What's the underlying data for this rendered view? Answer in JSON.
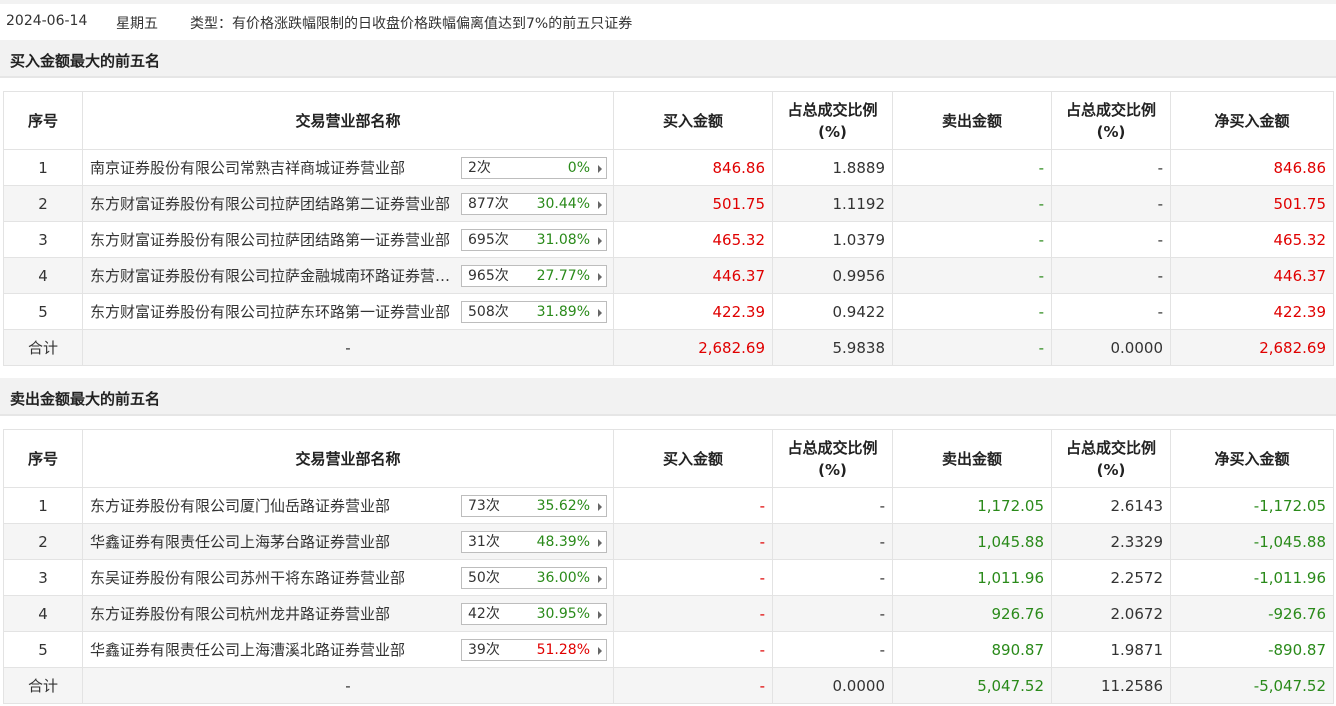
{
  "header": {
    "date": "2024-06-14",
    "weekday": "星期五",
    "type_text": "类型：有价格涨跌幅限制的日收盘价格跌幅偏离值达到7%的前五只证券"
  },
  "columns": {
    "seq": "序号",
    "name": "交易营业部名称",
    "buy": "买入金额",
    "buy_ratio_1": "占总成交比例",
    "buy_ratio_2": "(%)",
    "sell": "卖出金额",
    "sell_ratio_1": "占总成交比例",
    "sell_ratio_2": "(%)",
    "net": "净买入金额"
  },
  "buy_section": {
    "title": "买入金额最大的前五名",
    "rows": [
      {
        "seq": "1",
        "name": "南京证券股份有限公司常熟吉祥商城证券营业部",
        "count": "2次",
        "rate": "0%",
        "buy": "846.86",
        "buy_ratio": "1.8889",
        "sell": "-",
        "sell_ratio": "-",
        "net": "846.86"
      },
      {
        "seq": "2",
        "name": "东方财富证券股份有限公司拉萨团结路第二证券营业部",
        "count": "877次",
        "rate": "30.44%",
        "buy": "501.75",
        "buy_ratio": "1.1192",
        "sell": "-",
        "sell_ratio": "-",
        "net": "501.75"
      },
      {
        "seq": "3",
        "name": "东方财富证券股份有限公司拉萨团结路第一证券营业部",
        "count": "695次",
        "rate": "31.08%",
        "buy": "465.32",
        "buy_ratio": "1.0379",
        "sell": "-",
        "sell_ratio": "-",
        "net": "465.32"
      },
      {
        "seq": "4",
        "name": "东方财富证券股份有限公司拉萨金融城南环路证券营业部",
        "count": "965次",
        "rate": "27.77%",
        "buy": "446.37",
        "buy_ratio": "0.9956",
        "sell": "-",
        "sell_ratio": "-",
        "net": "446.37"
      },
      {
        "seq": "5",
        "name": "东方财富证券股份有限公司拉萨东环路第一证券营业部",
        "count": "508次",
        "rate": "31.89%",
        "buy": "422.39",
        "buy_ratio": "0.9422",
        "sell": "-",
        "sell_ratio": "-",
        "net": "422.39"
      }
    ],
    "total": {
      "label": "合计",
      "name": "-",
      "buy": "2,682.69",
      "buy_ratio": "5.9838",
      "sell": "-",
      "sell_ratio": "0.0000",
      "net": "2,682.69"
    }
  },
  "sell_section": {
    "title": "卖出金额最大的前五名",
    "rows": [
      {
        "seq": "1",
        "name": "东方证券股份有限公司厦门仙岳路证券营业部",
        "count": "73次",
        "rate": "35.62%",
        "buy": "-",
        "buy_ratio": "-",
        "sell": "1,172.05",
        "sell_ratio": "2.6143",
        "net": "-1,172.05"
      },
      {
        "seq": "2",
        "name": "华鑫证券有限责任公司上海茅台路证券营业部",
        "count": "31次",
        "rate": "48.39%",
        "buy": "-",
        "buy_ratio": "-",
        "sell": "1,045.88",
        "sell_ratio": "2.3329",
        "net": "-1,045.88"
      },
      {
        "seq": "3",
        "name": "东吴证券股份有限公司苏州干将东路证券营业部",
        "count": "50次",
        "rate": "36.00%",
        "buy": "-",
        "buy_ratio": "-",
        "sell": "1,011.96",
        "sell_ratio": "2.2572",
        "net": "-1,011.96"
      },
      {
        "seq": "4",
        "name": "东方证券股份有限公司杭州龙井路证券营业部",
        "count": "42次",
        "rate": "30.95%",
        "buy": "-",
        "buy_ratio": "-",
        "sell": "926.76",
        "sell_ratio": "2.0672",
        "net": "-926.76"
      },
      {
        "seq": "5",
        "name": "华鑫证券有限责任公司上海漕溪北路证券营业部",
        "count": "39次",
        "rate": "51.28%",
        "buy": "-",
        "buy_ratio": "-",
        "sell": "890.87",
        "sell_ratio": "1.9871",
        "net": "-890.87"
      }
    ],
    "total": {
      "label": "合计",
      "name": "-",
      "buy": "-",
      "buy_ratio": "0.0000",
      "sell": "5,047.52",
      "sell_ratio": "11.2586",
      "net": "-5,047.52"
    }
  },
  "colors": {
    "positive": "#e00000",
    "negative": "#2a8a1a",
    "header_bg": "#f2f2f2",
    "alt_row_bg": "#f5f5f5"
  }
}
